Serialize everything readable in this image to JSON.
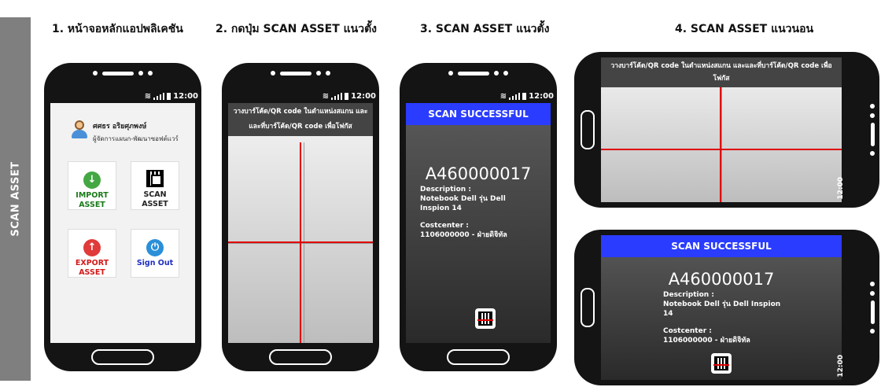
{
  "sidebar": {
    "label": "SCAN ASSET"
  },
  "steps": [
    {
      "title": "1. หน้าจอหลักแอปพลิเคชัน"
    },
    {
      "title": "2. กดปุ่ม SCAN ASSET แนวตั้ง"
    },
    {
      "title": "3. SCAN ASSET แนวตั้ง"
    },
    {
      "title": "4. SCAN ASSET แนวนอน"
    }
  ],
  "status": {
    "time": "12:00"
  },
  "home": {
    "user_name": "ศศธร อริยศุภพงษ์",
    "user_role": "ผู้จัดการแผนก-พัฒนาซอฟต์แวร์",
    "tiles": [
      {
        "label": "IMPORT ASSET",
        "color": "#1a7a1a",
        "icon": "download-icon"
      },
      {
        "label": "SCAN ASSET",
        "color": "#222222",
        "icon": "qr-code-icon"
      },
      {
        "label": "EXPORT ASSET",
        "color": "#d11a1a",
        "icon": "upload-icon"
      },
      {
        "label": "Sign Out",
        "color": "#1f2fbf",
        "icon": "power-icon"
      }
    ]
  },
  "scan": {
    "instruction": "วางบาร์โค้ด/QR code ในตำแหน่งสแกน และและที่บาร์โค้ด/QR code เพื่อโฟกัส"
  },
  "result": {
    "banner": "SCAN SUCCESSFUL",
    "asset_code": "A460000017",
    "description_label": "Description :",
    "description_value": "Notebook Dell รุ่น Dell Inspion 14",
    "costcenter_label": "Costcenter :",
    "costcenter_value": "1106000000 - ฝ่ายดิจิทัล"
  }
}
